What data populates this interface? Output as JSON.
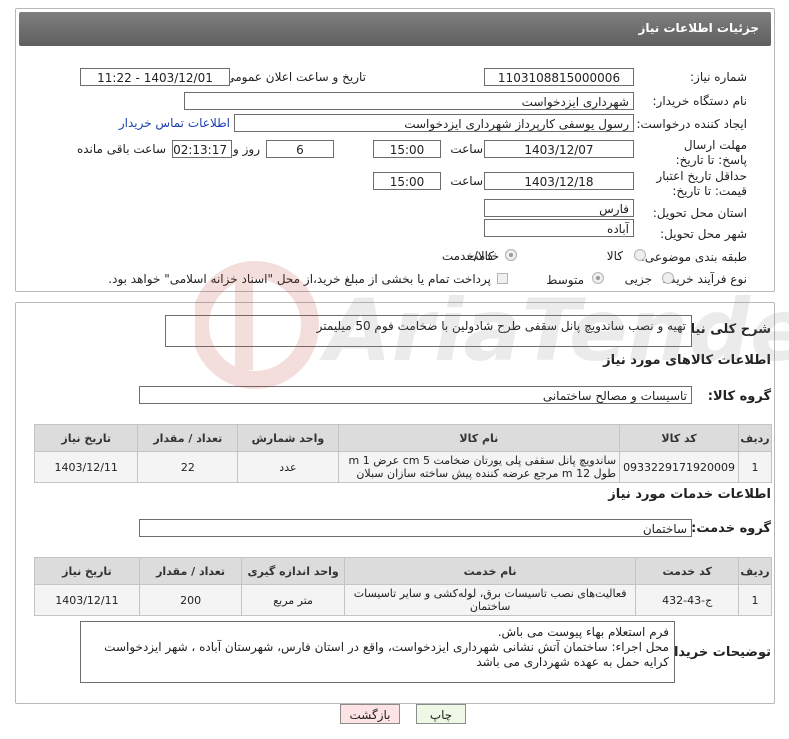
{
  "header": {
    "title": "جزئیات اطلاعات نیاز"
  },
  "fields": {
    "need_number_label": "شماره نیاز:",
    "need_number": "1103108815000006",
    "announce_label": "تاریخ و ساعت اعلان عمومی:",
    "announce_value": "1403/12/01 - 11:22",
    "buyer_label": "نام دستگاه خریدار:",
    "buyer": "شهرداری ایزدخواست",
    "creator_label": "ایجاد کننده درخواست:",
    "creator": "رسول یوسفی کارپرداز شهرداری ایزدخواست",
    "contact_link": "اطلاعات تماس خریدار",
    "deadline_label": "مهلت ارسال پاسخ: تا تاریخ:",
    "deadline_date": "1403/12/07",
    "time_label": "ساعت",
    "deadline_time": "15:00",
    "days_value": "6",
    "days_label": "روز و",
    "remaining_time": "02:13:17",
    "remaining_label": "ساعت باقی مانده",
    "validity_label": "حداقل تاریخ اعتبار قیمت: تا تاریخ:",
    "validity_date": "1403/12/18",
    "validity_time": "15:00",
    "province_label": "استان محل تحویل:",
    "province": "فارس",
    "city_label": "شهر محل تحویل:",
    "city": "آباده",
    "category_label": "طبقه بندی موضوعی:",
    "category_options": [
      "کالا",
      "خدمت",
      "کالا/خدمت"
    ],
    "process_label": "نوع فرآیند خرید :",
    "process_options": [
      "جزیی",
      "متوسط"
    ],
    "payment_note": "پرداخت تمام یا بخشی از مبلغ خرید،از محل \"اسناد خزانه اسلامی\" خواهد بود."
  },
  "summary": {
    "label": "شرح کلی نیاز:",
    "text": "تهیه و نصب ساندویچ پانل سقفی طرح شادولین با ضخامت فوم 50 میلیمتر"
  },
  "goods": {
    "section_title": "اطلاعات کالاهای مورد نیاز",
    "group_label": "گروه کالا:",
    "group_value": "تاسیسات و مصالح ساختمانی",
    "columns": [
      "ردیف",
      "کد کالا",
      "نام کالا",
      "واحد شمارش",
      "تعداد / مقدار",
      "تاریخ نیاز"
    ],
    "rows": [
      {
        "row": "1",
        "code": "0933229171920009",
        "name": "ساندویچ پانل سقفی پلی یورتان ضخامت 5 cm عرض 1 m طول 12 m مرجع عرضه کننده پیش ساخته سازان سبلان",
        "unit": "عدد",
        "qty": "22",
        "date": "1403/12/11"
      }
    ]
  },
  "services": {
    "section_title": "اطلاعات خدمات مورد نیاز",
    "group_label": "گروه خدمت:",
    "group_value": "ساختمان",
    "columns": [
      "ردیف",
      "کد خدمت",
      "نام خدمت",
      "واحد اندازه گیری",
      "تعداد / مقدار",
      "تاریخ نیاز"
    ],
    "rows": [
      {
        "row": "1",
        "code": "ج-43-432",
        "name": "فعالیت‌های نصب تاسیسات برق، لوله‌کشی و سایر تاسیسات ساختمان",
        "unit": "متر مربع",
        "qty": "200",
        "date": "1403/12/11"
      }
    ]
  },
  "buyer_notes": {
    "label": "توضیحات خریدار:",
    "line1": "فرم استعلام بهاء پیوست می باش.",
    "line2": "محل اجراء: ساختمان آتش نشانی شهرداری ایزدخواست، واقع در استان فارس، شهرستان آباده ، شهر ایزدخواست",
    "line3": "کرایه حمل  به عهده شهرداری می باشد"
  },
  "buttons": {
    "print": "چاپ",
    "back": "بازگشت"
  },
  "colors": {
    "header_bg": "#6f6f6f",
    "back_button_bg": "#fde3e3",
    "print_button_bg": "#eef8e6",
    "link": "#1a3fb0"
  },
  "icons": {
    "watermark": "ariatender-logo"
  }
}
